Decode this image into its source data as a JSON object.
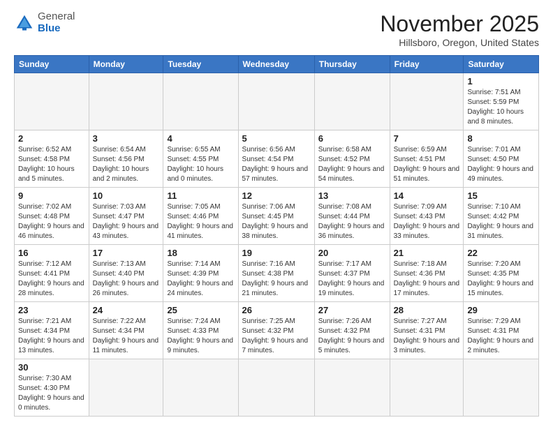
{
  "header": {
    "logo_general": "General",
    "logo_blue": "Blue",
    "month_title": "November 2025",
    "subtitle": "Hillsboro, Oregon, United States"
  },
  "weekdays": [
    "Sunday",
    "Monday",
    "Tuesday",
    "Wednesday",
    "Thursday",
    "Friday",
    "Saturday"
  ],
  "weeks": [
    [
      {
        "day": "",
        "info": ""
      },
      {
        "day": "",
        "info": ""
      },
      {
        "day": "",
        "info": ""
      },
      {
        "day": "",
        "info": ""
      },
      {
        "day": "",
        "info": ""
      },
      {
        "day": "",
        "info": ""
      },
      {
        "day": "1",
        "info": "Sunrise: 7:51 AM\nSunset: 5:59 PM\nDaylight: 10 hours and 8 minutes."
      }
    ],
    [
      {
        "day": "2",
        "info": "Sunrise: 6:52 AM\nSunset: 4:58 PM\nDaylight: 10 hours and 5 minutes."
      },
      {
        "day": "3",
        "info": "Sunrise: 6:54 AM\nSunset: 4:56 PM\nDaylight: 10 hours and 2 minutes."
      },
      {
        "day": "4",
        "info": "Sunrise: 6:55 AM\nSunset: 4:55 PM\nDaylight: 10 hours and 0 minutes."
      },
      {
        "day": "5",
        "info": "Sunrise: 6:56 AM\nSunset: 4:54 PM\nDaylight: 9 hours and 57 minutes."
      },
      {
        "day": "6",
        "info": "Sunrise: 6:58 AM\nSunset: 4:52 PM\nDaylight: 9 hours and 54 minutes."
      },
      {
        "day": "7",
        "info": "Sunrise: 6:59 AM\nSunset: 4:51 PM\nDaylight: 9 hours and 51 minutes."
      },
      {
        "day": "8",
        "info": "Sunrise: 7:01 AM\nSunset: 4:50 PM\nDaylight: 9 hours and 49 minutes."
      }
    ],
    [
      {
        "day": "9",
        "info": "Sunrise: 7:02 AM\nSunset: 4:48 PM\nDaylight: 9 hours and 46 minutes."
      },
      {
        "day": "10",
        "info": "Sunrise: 7:03 AM\nSunset: 4:47 PM\nDaylight: 9 hours and 43 minutes."
      },
      {
        "day": "11",
        "info": "Sunrise: 7:05 AM\nSunset: 4:46 PM\nDaylight: 9 hours and 41 minutes."
      },
      {
        "day": "12",
        "info": "Sunrise: 7:06 AM\nSunset: 4:45 PM\nDaylight: 9 hours and 38 minutes."
      },
      {
        "day": "13",
        "info": "Sunrise: 7:08 AM\nSunset: 4:44 PM\nDaylight: 9 hours and 36 minutes."
      },
      {
        "day": "14",
        "info": "Sunrise: 7:09 AM\nSunset: 4:43 PM\nDaylight: 9 hours and 33 minutes."
      },
      {
        "day": "15",
        "info": "Sunrise: 7:10 AM\nSunset: 4:42 PM\nDaylight: 9 hours and 31 minutes."
      }
    ],
    [
      {
        "day": "16",
        "info": "Sunrise: 7:12 AM\nSunset: 4:41 PM\nDaylight: 9 hours and 28 minutes."
      },
      {
        "day": "17",
        "info": "Sunrise: 7:13 AM\nSunset: 4:40 PM\nDaylight: 9 hours and 26 minutes."
      },
      {
        "day": "18",
        "info": "Sunrise: 7:14 AM\nSunset: 4:39 PM\nDaylight: 9 hours and 24 minutes."
      },
      {
        "day": "19",
        "info": "Sunrise: 7:16 AM\nSunset: 4:38 PM\nDaylight: 9 hours and 21 minutes."
      },
      {
        "day": "20",
        "info": "Sunrise: 7:17 AM\nSunset: 4:37 PM\nDaylight: 9 hours and 19 minutes."
      },
      {
        "day": "21",
        "info": "Sunrise: 7:18 AM\nSunset: 4:36 PM\nDaylight: 9 hours and 17 minutes."
      },
      {
        "day": "22",
        "info": "Sunrise: 7:20 AM\nSunset: 4:35 PM\nDaylight: 9 hours and 15 minutes."
      }
    ],
    [
      {
        "day": "23",
        "info": "Sunrise: 7:21 AM\nSunset: 4:34 PM\nDaylight: 9 hours and 13 minutes."
      },
      {
        "day": "24",
        "info": "Sunrise: 7:22 AM\nSunset: 4:34 PM\nDaylight: 9 hours and 11 minutes."
      },
      {
        "day": "25",
        "info": "Sunrise: 7:24 AM\nSunset: 4:33 PM\nDaylight: 9 hours and 9 minutes."
      },
      {
        "day": "26",
        "info": "Sunrise: 7:25 AM\nSunset: 4:32 PM\nDaylight: 9 hours and 7 minutes."
      },
      {
        "day": "27",
        "info": "Sunrise: 7:26 AM\nSunset: 4:32 PM\nDaylight: 9 hours and 5 minutes."
      },
      {
        "day": "28",
        "info": "Sunrise: 7:27 AM\nSunset: 4:31 PM\nDaylight: 9 hours and 3 minutes."
      },
      {
        "day": "29",
        "info": "Sunrise: 7:29 AM\nSunset: 4:31 PM\nDaylight: 9 hours and 2 minutes."
      }
    ],
    [
      {
        "day": "30",
        "info": "Sunrise: 7:30 AM\nSunset: 4:30 PM\nDaylight: 9 hours and 0 minutes."
      },
      {
        "day": "",
        "info": ""
      },
      {
        "day": "",
        "info": ""
      },
      {
        "day": "",
        "info": ""
      },
      {
        "day": "",
        "info": ""
      },
      {
        "day": "",
        "info": ""
      },
      {
        "day": "",
        "info": ""
      }
    ]
  ]
}
